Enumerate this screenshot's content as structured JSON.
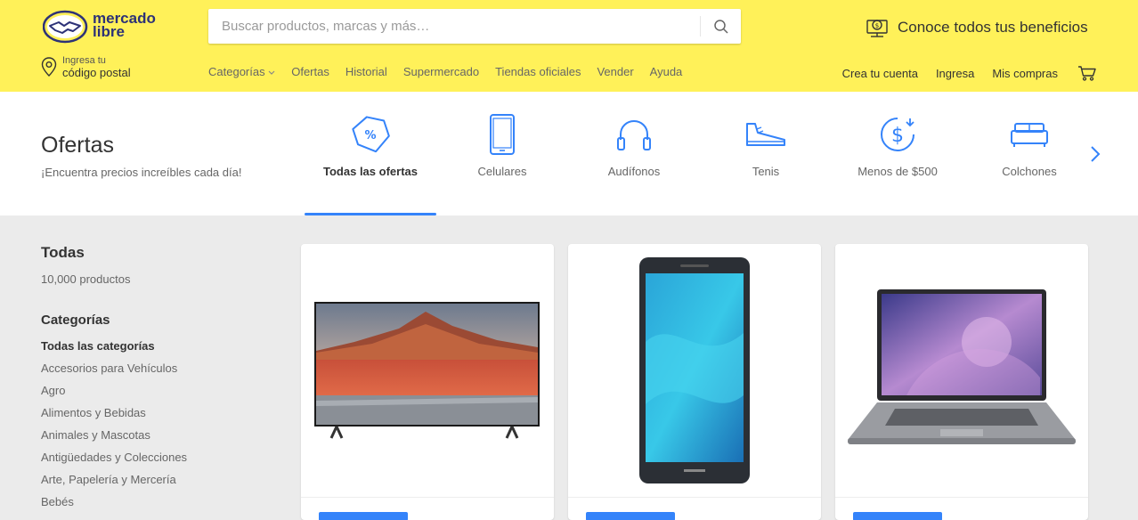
{
  "header": {
    "logo_line1": "mercado",
    "logo_line2": "libre",
    "search_placeholder": "Buscar productos, marcas y más…",
    "benefits": "Conoce todos tus beneficios",
    "location_small": "Ingresa tu",
    "location_big": "código postal",
    "nav": [
      "Categorías",
      "Ofertas",
      "Historial",
      "Supermercado",
      "Tiendas oficiales",
      "Vender",
      "Ayuda"
    ],
    "right_nav": [
      "Crea tu cuenta",
      "Ingresa",
      "Mis compras"
    ]
  },
  "offers": {
    "title": "Ofertas",
    "subtitle": "¡Encuentra precios increíbles cada día!",
    "categories": [
      {
        "label": "Todas las ofertas",
        "icon": "discount-tag-icon"
      },
      {
        "label": "Celulares",
        "icon": "phone-icon"
      },
      {
        "label": "Audífonos",
        "icon": "headphones-icon"
      },
      {
        "label": "Tenis",
        "icon": "sneaker-icon"
      },
      {
        "label": "Menos de $500",
        "icon": "dollar-coin-icon"
      },
      {
        "label": "Colchones",
        "icon": "bed-icon"
      }
    ]
  },
  "sidebar": {
    "title": "Todas",
    "count": "10,000 productos",
    "categories_title": "Categorías",
    "categories": [
      "Todas las categorías",
      "Accesorios para Vehículos",
      "Agro",
      "Alimentos y Bebidas",
      "Animales y Mascotas",
      "Antigüedades y Colecciones",
      "Arte, Papelería y Mercería",
      "Bebés"
    ]
  },
  "products": [
    {
      "name": "tv"
    },
    {
      "name": "smartphone"
    },
    {
      "name": "laptop"
    }
  ],
  "colors": {
    "brand_yellow": "#fff159",
    "accent_blue": "#3483fa",
    "logo_navy": "#2d3277"
  }
}
